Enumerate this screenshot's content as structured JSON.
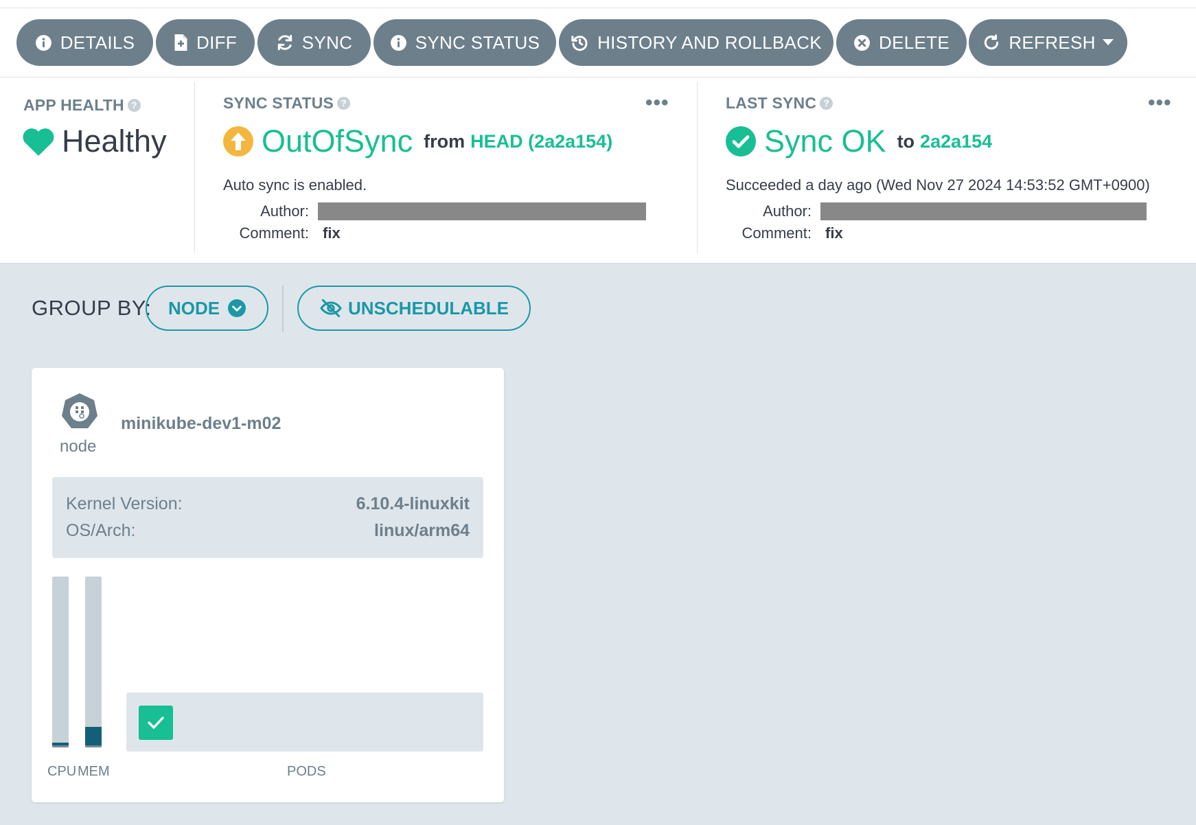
{
  "toolbar": {
    "details": "DETAILS",
    "diff": "DIFF",
    "sync": "SYNC",
    "sync_status": "SYNC STATUS",
    "history": "HISTORY AND ROLLBACK",
    "delete": "DELETE",
    "refresh": "REFRESH"
  },
  "app_health": {
    "title": "APP HEALTH",
    "status": "Healthy",
    "status_color": "#18be94"
  },
  "sync_status": {
    "title": "SYNC STATUS",
    "status": "OutOfSync",
    "status_color": "#18be94",
    "icon_color": "#f4b63f",
    "from_label": "from",
    "revision": "HEAD (2a2a154)",
    "auto_sync": "Auto sync is enabled.",
    "author_label": "Author:",
    "comment_label": "Comment:",
    "comment": "fix"
  },
  "last_sync": {
    "title": "LAST SYNC",
    "status": "Sync OK",
    "to_label": "to",
    "revision": "2a2a154",
    "succeeded": "Succeeded a day ago (Wed Nov 27 2024 14:53:52 GMT+0900)",
    "author_label": "Author:",
    "comment_label": "Comment:",
    "comment": "fix"
  },
  "group_by": {
    "label": "GROUP BY:",
    "node_button": "NODE",
    "unschedulable_button": "UNSCHEDULABLE"
  },
  "node": {
    "name": "minikube-dev1-m02",
    "type": "node",
    "kernel_label": "Kernel Version:",
    "kernel_value": "6.10.4-linuxkit",
    "os_label": "OS/Arch:",
    "os_value": "linux/arm64",
    "cpu_label": "CPU",
    "mem_label": "MEM",
    "pods_label": "PODS",
    "cpu_fraction": 0.03,
    "mem_fraction": 0.12,
    "pods_count": 1
  }
}
